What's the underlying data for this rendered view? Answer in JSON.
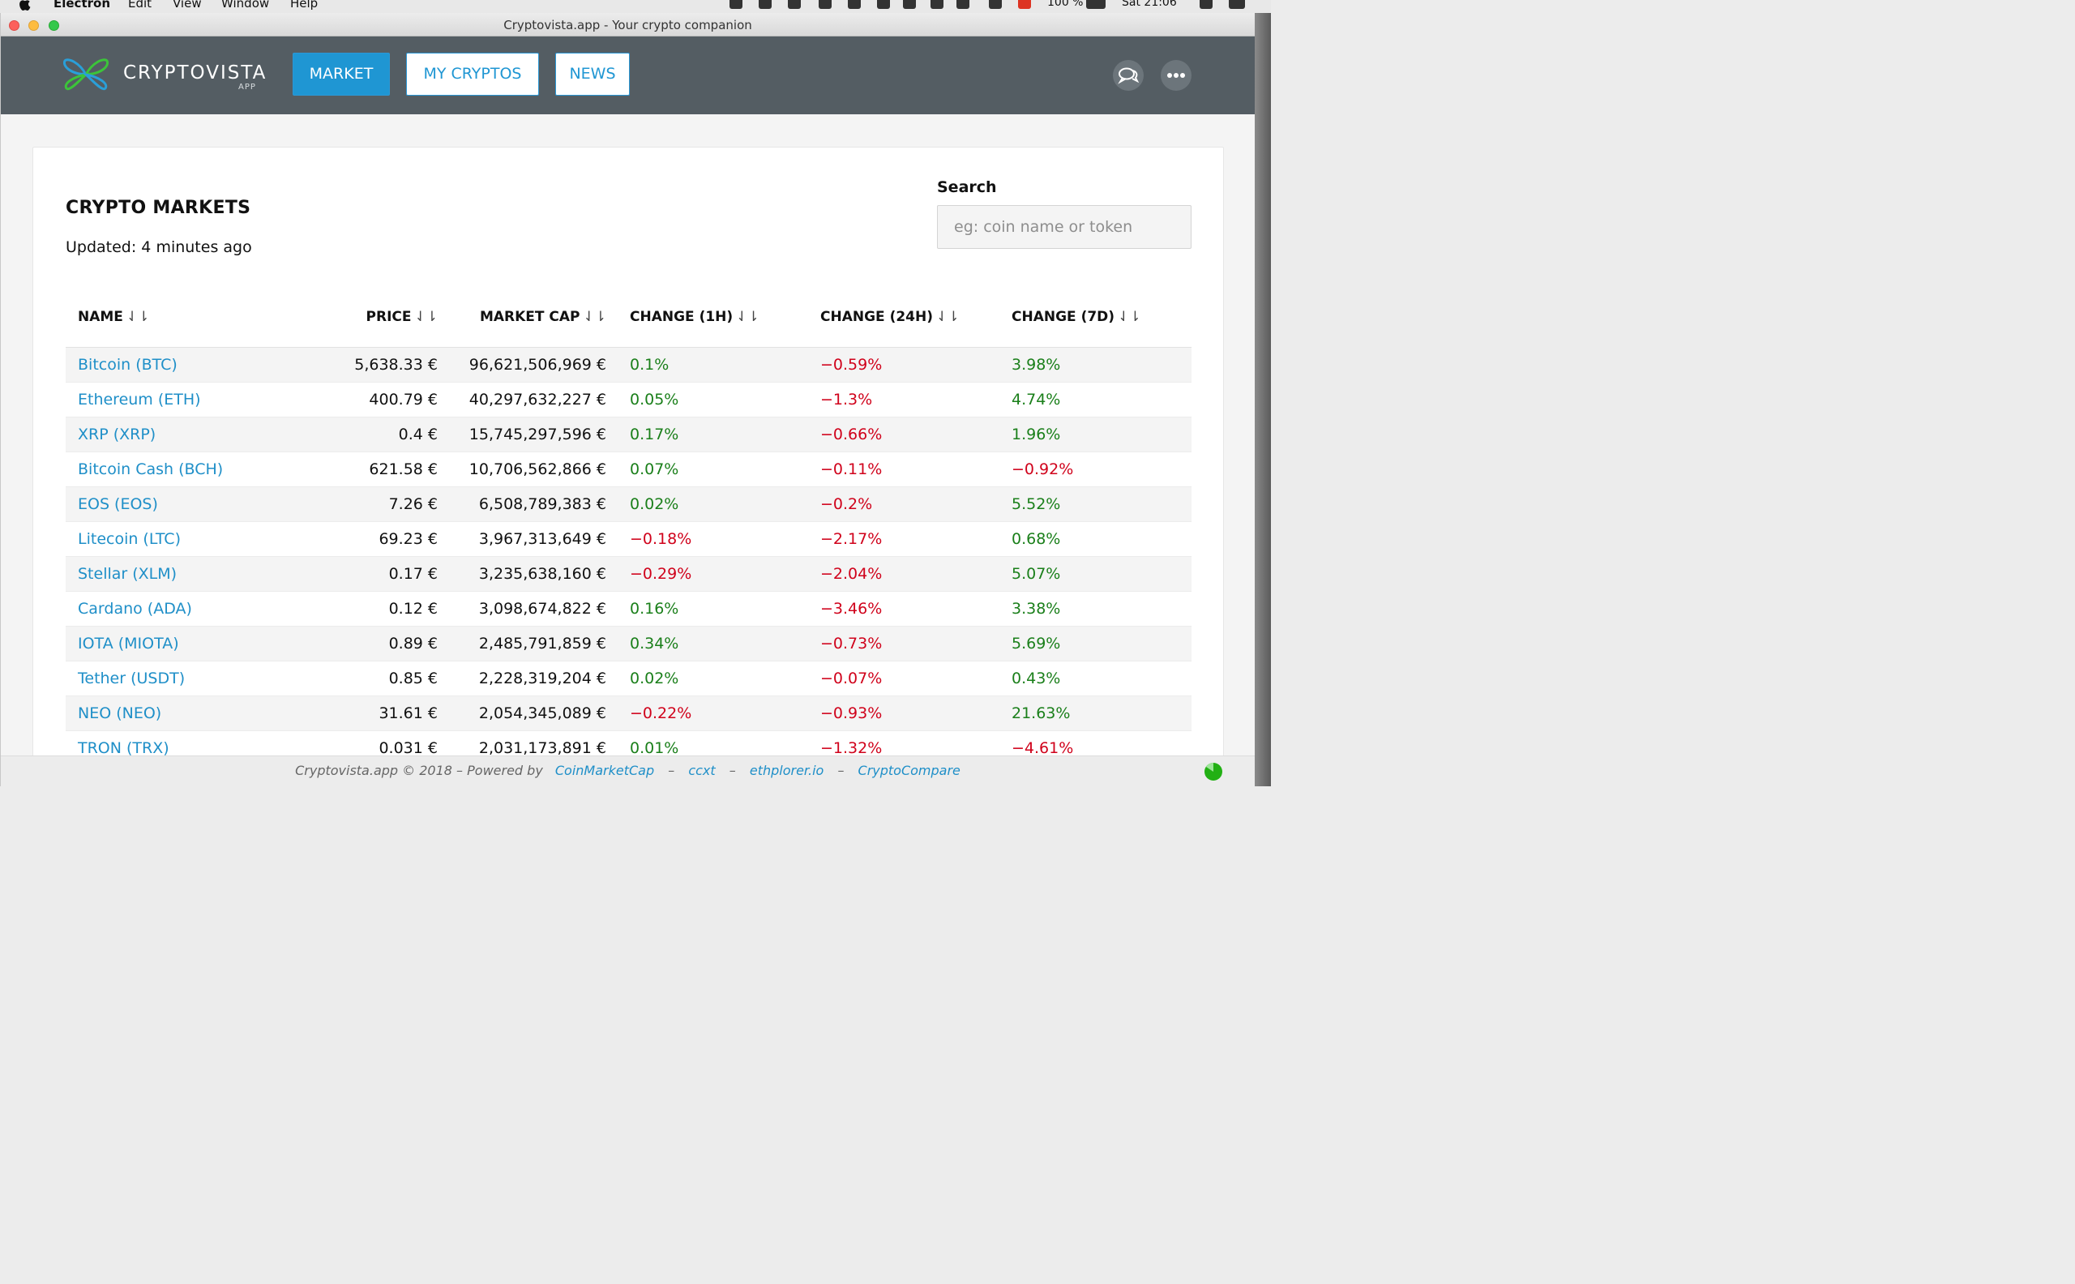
{
  "os_menubar": {
    "app_name": "Electron",
    "menus": [
      "Edit",
      "View",
      "Window",
      "Help"
    ],
    "battery": "100 %",
    "clock": "Sat 21:06"
  },
  "window": {
    "title": "Cryptovista.app - Your crypto companion"
  },
  "header": {
    "brand": "CRYPTOVISTA",
    "brand_sub": "APP",
    "nav": [
      {
        "label": "MARKET",
        "active": true
      },
      {
        "label": "MY CRYPTOS",
        "active": false
      },
      {
        "label": "NEWS",
        "active": false
      }
    ],
    "icons": [
      "chat-icon",
      "more-icon"
    ]
  },
  "main": {
    "title": "CRYPTO MARKETS",
    "updated": "Updated: 4 minutes ago",
    "search": {
      "label": "Search",
      "placeholder": "eg: coin name or token",
      "value": ""
    },
    "columns": [
      "NAME",
      "PRICE",
      "MARKET CAP",
      "CHANGE (1H)",
      "CHANGE (24H)",
      "CHANGE (7D)"
    ],
    "sort_icon": "⇃⇂",
    "rows": [
      {
        "name": "Bitcoin (BTC)",
        "price": "5,638.33 €",
        "market_cap": "96,621,506,969 €",
        "change_1h": "0.1%",
        "change_24h": "−0.59%",
        "change_7d": "3.98%"
      },
      {
        "name": "Ethereum (ETH)",
        "price": "400.79 €",
        "market_cap": "40,297,632,227 €",
        "change_1h": "0.05%",
        "change_24h": "−1.3%",
        "change_7d": "4.74%"
      },
      {
        "name": "XRP (XRP)",
        "price": "0.4 €",
        "market_cap": "15,745,297,596 €",
        "change_1h": "0.17%",
        "change_24h": "−0.66%",
        "change_7d": "1.96%"
      },
      {
        "name": "Bitcoin Cash (BCH)",
        "price": "621.58 €",
        "market_cap": "10,706,562,866 €",
        "change_1h": "0.07%",
        "change_24h": "−0.11%",
        "change_7d": "−0.92%"
      },
      {
        "name": "EOS (EOS)",
        "price": "7.26 €",
        "market_cap": "6,508,789,383 €",
        "change_1h": "0.02%",
        "change_24h": "−0.2%",
        "change_7d": "5.52%"
      },
      {
        "name": "Litecoin (LTC)",
        "price": "69.23 €",
        "market_cap": "3,967,313,649 €",
        "change_1h": "−0.18%",
        "change_24h": "−2.17%",
        "change_7d": "0.68%"
      },
      {
        "name": "Stellar (XLM)",
        "price": "0.17 €",
        "market_cap": "3,235,638,160 €",
        "change_1h": "−0.29%",
        "change_24h": "−2.04%",
        "change_7d": "5.07%"
      },
      {
        "name": "Cardano (ADA)",
        "price": "0.12 €",
        "market_cap": "3,098,674,822 €",
        "change_1h": "0.16%",
        "change_24h": "−3.46%",
        "change_7d": "3.38%"
      },
      {
        "name": "IOTA (MIOTA)",
        "price": "0.89 €",
        "market_cap": "2,485,791,859 €",
        "change_1h": "0.34%",
        "change_24h": "−0.73%",
        "change_7d": "5.69%"
      },
      {
        "name": "Tether (USDT)",
        "price": "0.85 €",
        "market_cap": "2,228,319,204 €",
        "change_1h": "0.02%",
        "change_24h": "−0.07%",
        "change_7d": "0.43%"
      },
      {
        "name": "NEO (NEO)",
        "price": "31.61 €",
        "market_cap": "2,054,345,089 €",
        "change_1h": "−0.22%",
        "change_24h": "−0.93%",
        "change_7d": "21.63%"
      },
      {
        "name": "TRON (TRX)",
        "price": "0.031 €",
        "market_cap": "2,031,173,891 €",
        "change_1h": "0.01%",
        "change_24h": "−1.32%",
        "change_7d": "−4.61%"
      }
    ]
  },
  "footer": {
    "prefix": "Cryptovista.app © 2018 – Powered by",
    "links": [
      "CoinMarketCap",
      "ccxt",
      "ethplorer.io",
      "CryptoCompare"
    ],
    "separator": "–"
  },
  "colors": {
    "header_bg": "#545d63",
    "accent_blue": "#1f96d3",
    "positive": "#1a7f1a",
    "negative": "#d0021b"
  }
}
